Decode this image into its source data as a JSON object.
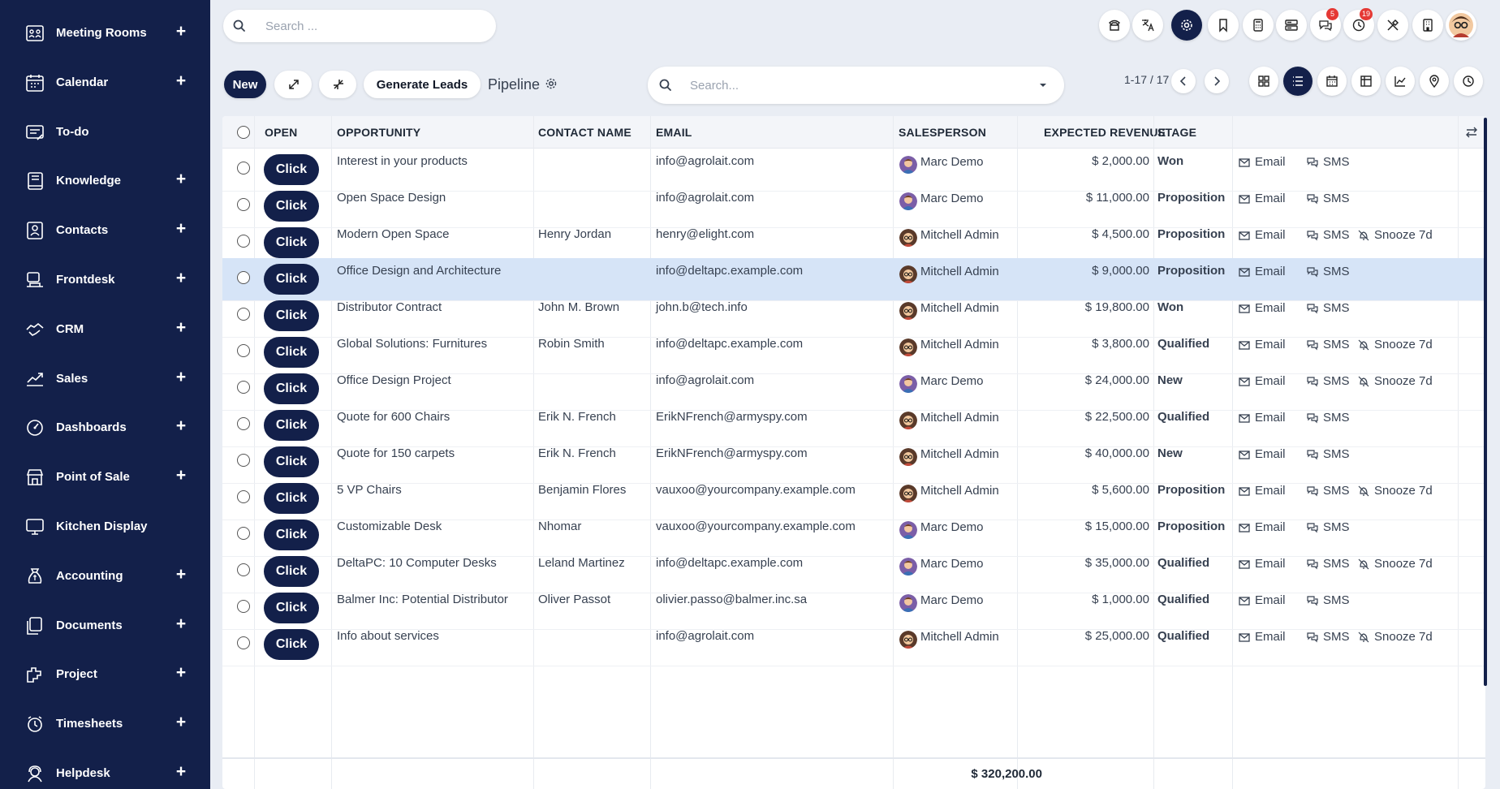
{
  "sidebar": {
    "items": [
      {
        "label": "Meeting Rooms",
        "plus": true,
        "icon": "meeting-rooms-icon"
      },
      {
        "label": "Calendar",
        "plus": true,
        "icon": "calendar-icon"
      },
      {
        "label": "To-do",
        "plus": false,
        "icon": "todo-icon"
      },
      {
        "label": "Knowledge",
        "plus": true,
        "icon": "knowledge-icon"
      },
      {
        "label": "Contacts",
        "plus": true,
        "icon": "contacts-icon"
      },
      {
        "label": "Frontdesk",
        "plus": true,
        "icon": "frontdesk-icon"
      },
      {
        "label": "CRM",
        "plus": true,
        "icon": "crm-icon"
      },
      {
        "label": "Sales",
        "plus": true,
        "icon": "sales-icon"
      },
      {
        "label": "Dashboards",
        "plus": true,
        "icon": "dashboards-icon"
      },
      {
        "label": "Point of Sale",
        "plus": true,
        "icon": "point-of-sale-icon"
      },
      {
        "label": "Kitchen Display",
        "plus": false,
        "icon": "kitchen-display-icon"
      },
      {
        "label": "Accounting",
        "plus": true,
        "icon": "accounting-icon"
      },
      {
        "label": "Documents",
        "plus": true,
        "icon": "documents-icon"
      },
      {
        "label": "Project",
        "plus": true,
        "icon": "project-icon"
      },
      {
        "label": "Timesheets",
        "plus": true,
        "icon": "timesheets-icon"
      },
      {
        "label": "Helpdesk",
        "plus": true,
        "icon": "helpdesk-icon"
      }
    ],
    "plus_symbol": "+"
  },
  "topbar": {
    "search_placeholder": "Search ...",
    "icons": [
      "phone-icon",
      "translate-icon",
      "settings-icon",
      "bookmark-icon",
      "calculator-icon",
      "server-icon",
      "messages-icon",
      "activities-icon",
      "tools-icon",
      "company-icon",
      "user-avatar"
    ],
    "messages_badge": "5",
    "activities_badge": "19"
  },
  "controlbar": {
    "new_label": "New",
    "generate_leads_label": "Generate Leads",
    "pipeline_label": "Pipeline",
    "search_placeholder": "Search...",
    "pager": "1-17 / 17",
    "views": [
      "kanban-view-icon",
      "list-view-icon",
      "calendar-view-icon",
      "pivot-view-icon",
      "graph-view-icon",
      "map-view-icon",
      "activity-view-icon"
    ],
    "active_view": "list-view-icon"
  },
  "table": {
    "headers": {
      "open": "OPEN",
      "opportunity": "OPPORTUNITY",
      "contact": "CONTACT NAME",
      "email": "EMAIL",
      "salesperson": "SALESPERSON",
      "revenue": "EXPECTED REVENUE",
      "stage": "STAGE"
    },
    "click_label": "Click",
    "email_label": "Email",
    "sms_label": "SMS",
    "snooze_label": "Snooze 7d",
    "rows": [
      {
        "opportunity": "Interest in your products",
        "contact": "",
        "email": "info@agrolait.com",
        "salesperson": "Marc Demo",
        "revenue": "$ 2,000.00",
        "stage": "Won",
        "snooze": false,
        "highlight": false
      },
      {
        "opportunity": "Open Space Design",
        "contact": "",
        "email": "info@agrolait.com",
        "salesperson": "Marc Demo",
        "revenue": "$ 11,000.00",
        "stage": "Proposition",
        "snooze": false,
        "highlight": false
      },
      {
        "opportunity": "Modern Open Space",
        "contact": "Henry Jordan",
        "email": "henry@elight.com",
        "salesperson": "Mitchell Admin",
        "revenue": "$ 4,500.00",
        "stage": "Proposition",
        "snooze": true,
        "highlight": false
      },
      {
        "opportunity": "Office Design and Architecture",
        "contact": "",
        "email": "info@deltapc.example.com",
        "salesperson": "Mitchell Admin",
        "revenue": "$ 9,000.00",
        "stage": "Proposition",
        "snooze": false,
        "highlight": true
      },
      {
        "opportunity": "Distributor Contract",
        "contact": "John M. Brown",
        "email": "john.b@tech.info",
        "salesperson": "Mitchell Admin",
        "revenue": "$ 19,800.00",
        "stage": "Won",
        "snooze": false,
        "highlight": false
      },
      {
        "opportunity": "Global Solutions: Furnitures",
        "contact": "Robin Smith",
        "email": "info@deltapc.example.com",
        "salesperson": "Mitchell Admin",
        "revenue": "$ 3,800.00",
        "stage": "Qualified",
        "snooze": true,
        "highlight": false
      },
      {
        "opportunity": "Office Design Project",
        "contact": "",
        "email": "info@agrolait.com",
        "salesperson": "Marc Demo",
        "revenue": "$ 24,000.00",
        "stage": "New",
        "snooze": true,
        "highlight": false
      },
      {
        "opportunity": "Quote for 600 Chairs",
        "contact": "Erik N. French",
        "email": "ErikNFrench@armyspy.com",
        "salesperson": "Mitchell Admin",
        "revenue": "$ 22,500.00",
        "stage": "Qualified",
        "snooze": false,
        "highlight": false
      },
      {
        "opportunity": "Quote for 150 carpets",
        "contact": "Erik N. French",
        "email": "ErikNFrench@armyspy.com",
        "salesperson": "Mitchell Admin",
        "revenue": "$ 40,000.00",
        "stage": "New",
        "snooze": false,
        "highlight": false
      },
      {
        "opportunity": "5 VP Chairs",
        "contact": "Benjamin Flores",
        "email": "vauxoo@yourcompany.example.com",
        "salesperson": "Mitchell Admin",
        "revenue": "$ 5,600.00",
        "stage": "Proposition",
        "snooze": true,
        "highlight": false
      },
      {
        "opportunity": "Customizable Desk",
        "contact": "Nhomar",
        "email": "vauxoo@yourcompany.example.com",
        "salesperson": "Marc Demo",
        "revenue": "$ 15,000.00",
        "stage": "Proposition",
        "snooze": false,
        "highlight": false
      },
      {
        "opportunity": "DeltaPC: 10 Computer Desks",
        "contact": "Leland Martinez",
        "email": "info@deltapc.example.com",
        "salesperson": "Marc Demo",
        "revenue": "$ 35,000.00",
        "stage": "Qualified",
        "snooze": true,
        "highlight": false
      },
      {
        "opportunity": "Balmer Inc: Potential Distributor",
        "contact": "Oliver Passot",
        "email": "olivier.passo@balmer.inc.sa",
        "salesperson": "Marc Demo",
        "revenue": "$ 1,000.00",
        "stage": "Qualified",
        "snooze": false,
        "highlight": false
      },
      {
        "opportunity": "Info about services",
        "contact": "",
        "email": "info@agrolait.com",
        "salesperson": "Mitchell Admin",
        "revenue": "$ 25,000.00",
        "stage": "Qualified",
        "snooze": true,
        "highlight": false
      }
    ],
    "total_revenue": "$ 320,200.00"
  }
}
